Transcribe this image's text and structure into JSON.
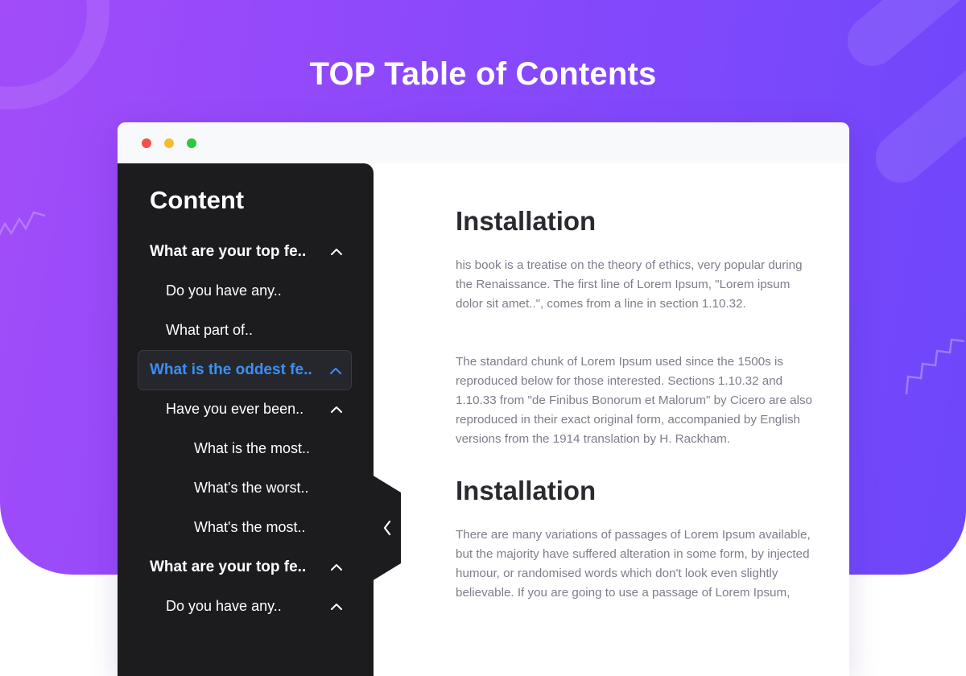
{
  "page": {
    "title": "TOP Table of Contents"
  },
  "colors": {
    "accent": "#3b8ff6",
    "sidebar_bg": "#1c1c1f",
    "hero_gradient": [
      "#a24cf9",
      "#6d47fb"
    ]
  },
  "sidebar": {
    "title": "Content",
    "items": [
      {
        "label": "What are your top fe..",
        "level": 1,
        "expanded": true,
        "active": false
      },
      {
        "label": "Do you have any..",
        "level": 2,
        "expanded": false,
        "active": false
      },
      {
        "label": "What part of..",
        "level": 2,
        "expanded": false,
        "active": false
      },
      {
        "label": "What is the oddest fe..",
        "level": 1,
        "expanded": true,
        "active": true
      },
      {
        "label": "Have you ever been..",
        "level": 2,
        "expanded": true,
        "active": false
      },
      {
        "label": "What is the most..",
        "level": 3,
        "expanded": false,
        "active": false
      },
      {
        "label": "What's the worst..",
        "level": 3,
        "expanded": false,
        "active": false
      },
      {
        "label": "What's the most..",
        "level": 3,
        "expanded": false,
        "active": false
      },
      {
        "label": "What are your top fe..",
        "level": 1,
        "expanded": true,
        "active": false
      },
      {
        "label": "Do you have any..",
        "level": 2,
        "expanded": true,
        "active": false
      }
    ],
    "collapse_icon": "chevron-left-icon"
  },
  "article": {
    "sections": [
      {
        "heading": "Installation",
        "paragraphs": [
          "his book is a treatise on the theory of ethics, very popular during the Renaissance. The first line of Lorem Ipsum, \"Lorem ipsum dolor sit amet..\", comes from a line in section 1.10.32.",
          "The standard chunk of Lorem Ipsum used since the 1500s is reproduced below for those interested. Sections 1.10.32 and 1.10.33 from \"de Finibus Bonorum et Malorum\" by Cicero are also reproduced in their exact original form, accompanied by English versions from the 1914 translation by H. Rackham."
        ]
      },
      {
        "heading": "Installation",
        "paragraphs": [
          "There are many variations of passages of Lorem Ipsum available, but the majority have suffered alteration in some form, by injected humour, or randomised words which don't look even slightly believable. If you are going to use a passage of Lorem Ipsum,"
        ]
      }
    ]
  }
}
